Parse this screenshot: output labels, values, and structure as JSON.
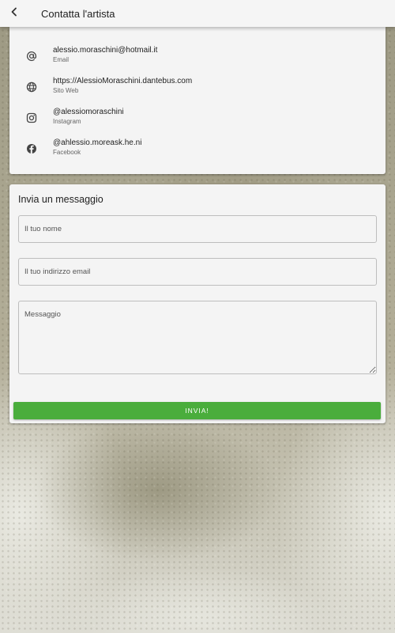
{
  "header": {
    "title": "Contatta l'artista",
    "back_icon": "chevron-left-icon"
  },
  "contacts": [
    {
      "icon": "at-icon",
      "value": "alessio.moraschini@hotmail.it",
      "label": "Email"
    },
    {
      "icon": "globe-icon",
      "value": "https://AlessioMoraschini.dantebus.com",
      "label": "Sito Web"
    },
    {
      "icon": "instagram-icon",
      "value": "@alessiomoraschini",
      "label": "Instagram"
    },
    {
      "icon": "facebook-icon",
      "value": "@ahlessio.moreask.he.ni",
      "label": "Facebook"
    }
  ],
  "form": {
    "title": "Invia un messaggio",
    "name_placeholder": "Il tuo nome",
    "email_placeholder": "Il tuo indirizzo email",
    "message_placeholder": "Messaggio",
    "send_label": "INVIA!"
  },
  "colors": {
    "app_bar": "#f5f5f5",
    "card": "#f4f4f4",
    "send_button": "#4aad3c"
  }
}
